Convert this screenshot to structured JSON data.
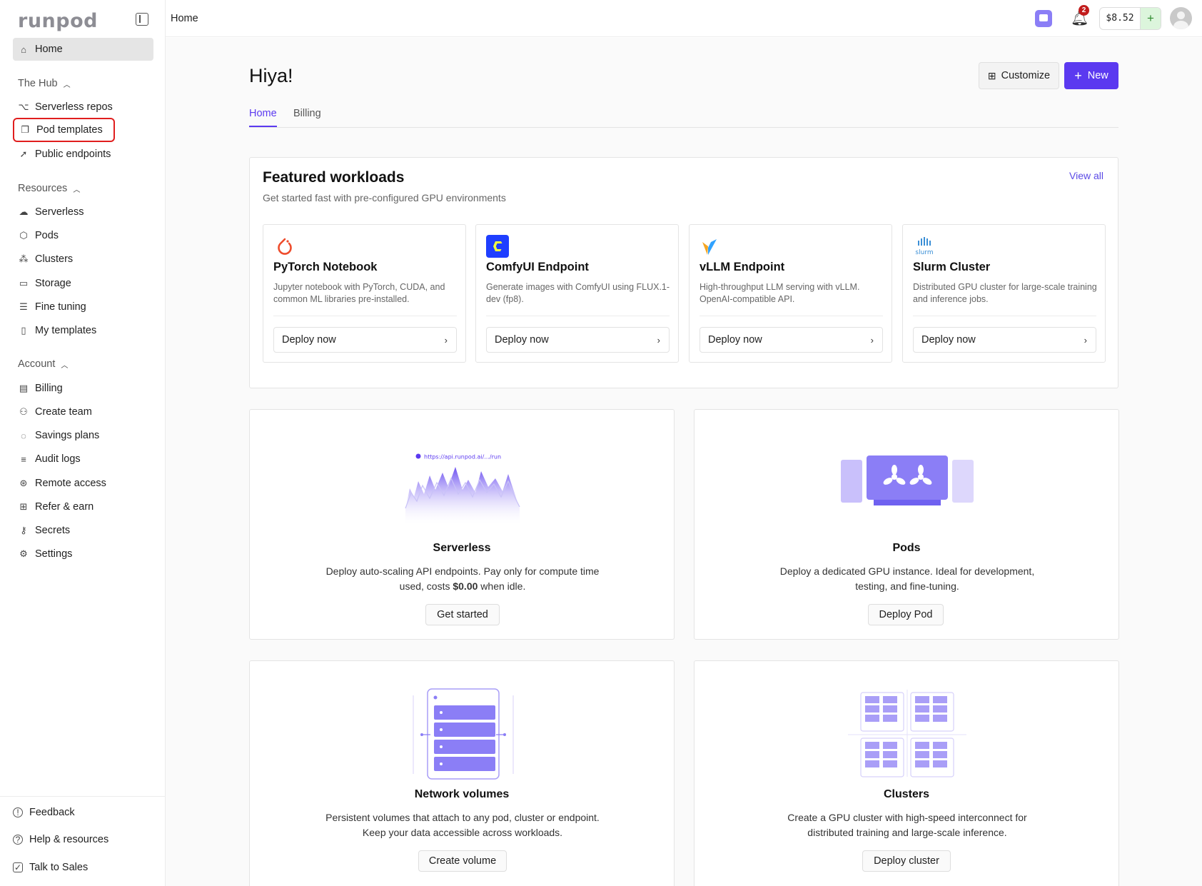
{
  "app": {
    "logo": "runpod"
  },
  "topbar": {
    "breadcrumb": "Home",
    "notification_count": "2",
    "balance": "$8.52",
    "add_funds": "+"
  },
  "sidebar": {
    "home": "Home",
    "hub": {
      "title": "The Hub",
      "items": [
        "Serverless repos",
        "Pod templates",
        "Public endpoints"
      ]
    },
    "resources": {
      "title": "Resources",
      "items": [
        "Serverless",
        "Pods",
        "Clusters",
        "Storage",
        "Fine tuning",
        "My templates"
      ]
    },
    "account": {
      "title": "Account",
      "items": [
        "Billing",
        "Create team",
        "Savings plans",
        "Audit logs",
        "Remote access",
        "Refer & earn",
        "Secrets",
        "Settings"
      ]
    },
    "footer": [
      "Feedback",
      "Help & resources",
      "Talk to Sales"
    ]
  },
  "page": {
    "title": "Hiya!",
    "customize": "Customize",
    "new": "New",
    "tabs": [
      "Home",
      "Billing"
    ]
  },
  "featured": {
    "title": "Featured workloads",
    "subtitle": "Get started fast with pre-configured GPU environments",
    "view_all": "View all",
    "cards": [
      {
        "name": "PyTorch Notebook",
        "desc": "Jupyter notebook with PyTorch, CUDA, and common ML libraries pre-installed.",
        "cta": "Deploy now"
      },
      {
        "name": "ComfyUI Endpoint",
        "desc": "Generate images with ComfyUI using FLUX.1-dev (fp8).",
        "cta": "Deploy now"
      },
      {
        "name": "vLLM Endpoint",
        "desc": "High-throughput LLM serving with vLLM. OpenAI-compatible API.",
        "cta": "Deploy now"
      },
      {
        "name": "Slurm Cluster",
        "desc": "Distributed GPU cluster for large-scale training and inference jobs.",
        "cta": "Deploy now"
      }
    ],
    "slurm_logo_text": "slurm"
  },
  "products": {
    "serverless": {
      "title": "Serverless",
      "desc_pre": "Deploy auto-scaling API endpoints. Pay only for compute time used, costs ",
      "desc_bold": "$0.00",
      "desc_post": " when idle.",
      "cta": "Get started",
      "url_label": "https://api.runpod.ai/.../run"
    },
    "pods": {
      "title": "Pods",
      "desc": "Deploy a dedicated GPU instance. Ideal for development, testing, and fine-tuning.",
      "cta": "Deploy Pod"
    },
    "volumes": {
      "title": "Network volumes",
      "desc": "Persistent volumes that attach to any pod, cluster or endpoint. Keep your data accessible across workloads.",
      "cta": "Create volume"
    },
    "clusters": {
      "title": "Clusters",
      "desc": "Create a GPU cluster with high-speed interconnect for distributed training and large-scale inference.",
      "cta": "Deploy cluster"
    }
  },
  "colors": {
    "accent": "#5b39f0",
    "highlight": "#e01e1e",
    "illustration": "#8b7ef6"
  }
}
